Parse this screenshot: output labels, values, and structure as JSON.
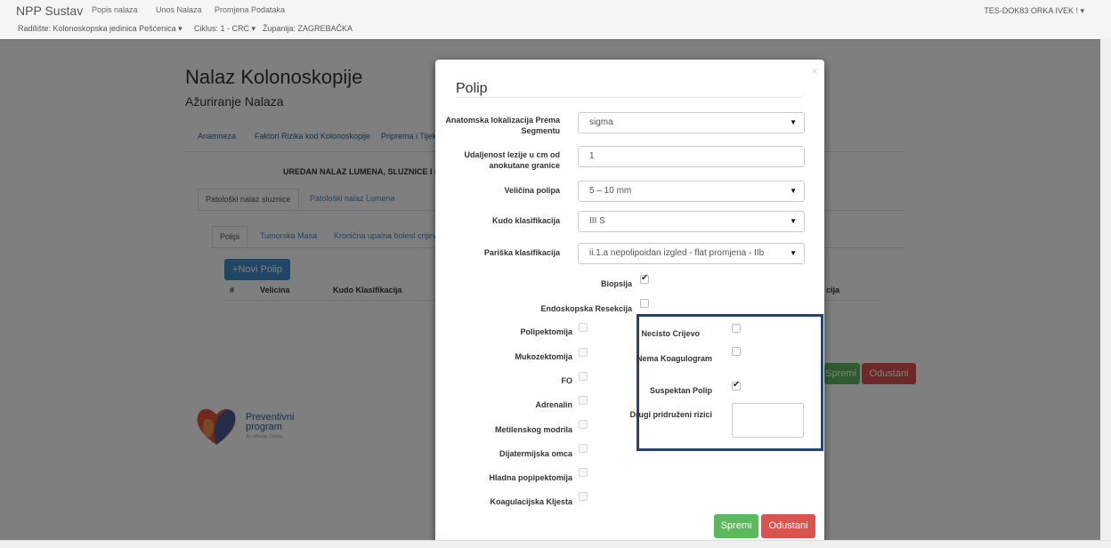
{
  "navbar": {
    "brand": "NPP Sustav",
    "links": [
      "Popis nalaza",
      "Unos Nalaza",
      "Promjena Podataka"
    ],
    "radiliste": "Radilište: Kolonoskopska jedinica Pešćenica",
    "ciklus": "Ciklus: 1 - CRC",
    "zupanija": "Županija: ZAGREBAČKA",
    "user": "TES-DOK83 ORKA IVEK !"
  },
  "page": {
    "title": "Nalaz Kolonoskopije",
    "subtitle": "Ažuriranje Nalaza",
    "tabs": [
      "Anamneza",
      "Faktori Rizika kod Kolonoskopije",
      "Priprema i Tijek"
    ],
    "status_line": "UREDAN NALAZ LUMENA, SLUZNICE I PERI",
    "sub_tabs": [
      "Patološki nalaz sluznice",
      "Patološki nalaz Lumena"
    ],
    "inner_tabs": [
      "Polipi",
      "Tumorska Masa",
      "Kronična upalna bolest crijeva"
    ],
    "new_polyp_button": "+Novi Polip",
    "table_headers": [
      "#",
      "Velicina",
      "Kudo Klasifikacija"
    ],
    "table_header_right": "cija",
    "save_button": "Spremi",
    "cancel_button": "Odustani",
    "logo_text": [
      "Preventivni",
      "program"
    ],
    "logo_tagline": "Za zdravije. Danas."
  },
  "modal": {
    "title": "Polip",
    "close": "×",
    "fields": {
      "anatomska_label": "Anatomska lokalizacija Prema Segmentu",
      "anatomska_value": "sigma",
      "udaljenost_label": "Udaljenost lezije u cm od anokutane granice",
      "udaljenost_value": "1",
      "velicina_label": "Veličina polipa",
      "velicina_value": "5 – 10 mm",
      "kudo_label": "Kudo klasifikacija",
      "kudo_value": "III S",
      "pariska_label": "Pariška klasifikacija",
      "pariska_value": "ii.1.a nepolipoidan izgled - flat promjena - IIb"
    },
    "checkboxes_top": [
      {
        "label": "Biopsija",
        "checked": true
      },
      {
        "label": "Endoskopska Resekcija",
        "checked": false
      }
    ],
    "checkboxes_left": [
      {
        "label": "Polipektomija",
        "checked": false
      },
      {
        "label": "Mukozektomija",
        "checked": false
      },
      {
        "label": "FO",
        "checked": false
      },
      {
        "label": "Adrenalin",
        "checked": false
      },
      {
        "label": "Metilenskog modrila",
        "checked": false
      },
      {
        "label": "Dijatermijska omca",
        "checked": false
      },
      {
        "label": "Hladna popipektomija",
        "checked": false
      },
      {
        "label": "Koagulacijska Kljesta",
        "checked": false
      }
    ],
    "checkboxes_right": [
      {
        "label": "Necisto Crijevo",
        "checked": false
      },
      {
        "label": "Nema Koagulogram",
        "checked": false
      },
      {
        "label": "Suspektan Polip",
        "checked": true
      }
    ],
    "drugi_label": "Drugi pridruženi rizici",
    "save_button": "Spremi",
    "cancel_button": "Odustani"
  },
  "colors": {
    "success": "#5cb85c",
    "danger": "#d9534f",
    "primary": "#428bca",
    "highlight_border": "#26456e"
  }
}
